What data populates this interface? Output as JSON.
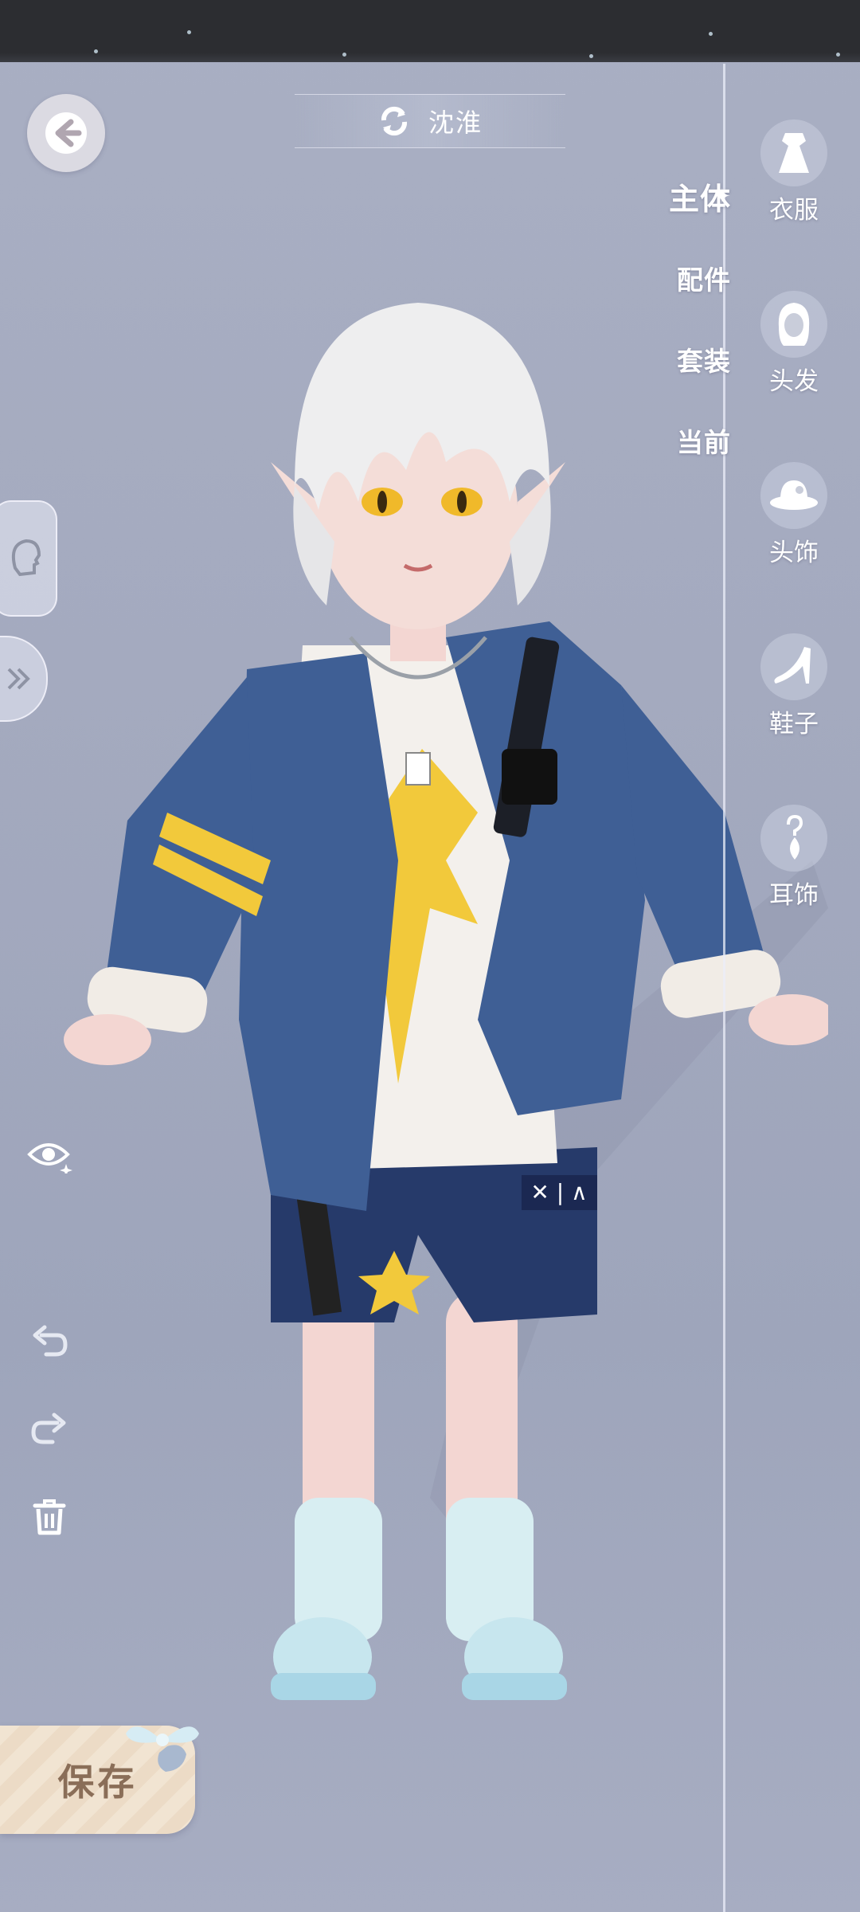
{
  "character": {
    "name": "沈淮"
  },
  "subnav": {
    "items": [
      "主体",
      "配件",
      "套装",
      "当前"
    ],
    "active": "主体"
  },
  "categories": [
    {
      "label": "衣服",
      "icon": "dress-icon"
    },
    {
      "label": "头发",
      "icon": "hair-icon"
    },
    {
      "label": "头饰",
      "icon": "hat-icon"
    },
    {
      "label": "鞋子",
      "icon": "shoe-icon"
    },
    {
      "label": "耳饰",
      "icon": "earring-icon"
    }
  ],
  "actions": {
    "save_label": "保存"
  },
  "tools": [
    "eye-icon",
    "undo-icon",
    "redo-icon",
    "trash-icon"
  ],
  "colors": {
    "accent_text": "#ffffff",
    "save_text": "#8a6e58",
    "jacket": "#3f5f95",
    "star": "#f2c93b"
  }
}
